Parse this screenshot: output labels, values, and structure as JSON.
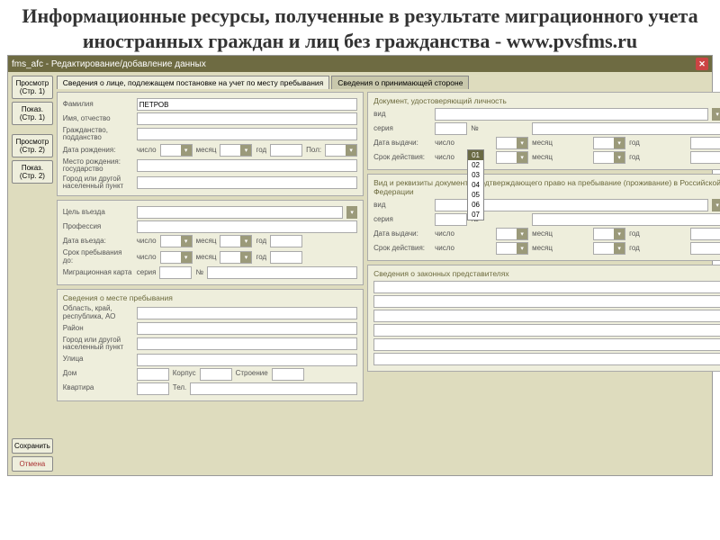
{
  "page_title": "Информационные ресурсы, полученные в результате миграционного учета иностранных граждан и лиц без гражданства - www.pvsfms.ru",
  "window_title": "fms_afc - Редактирование/добавление данных",
  "sidebar": {
    "view_p1": "Просмотр (Стр. 1)",
    "copy_p1": "Показ. (Стр. 1)",
    "view_p2": "Просмотр (Стр. 2)",
    "copy_p2": "Показ. (Стр. 2)",
    "save": "Сохранить",
    "cancel": "Отмена"
  },
  "tabs": {
    "main": "Сведения о лице, подлежащем постановке на учет по месту пребывания",
    "host": "Сведения о принимающей стороне"
  },
  "person": {
    "surname_lbl": "Фамилия",
    "surname_val": "ПЕТРОВ",
    "name_lbl": "Имя, отчество",
    "citizenship_lbl": "Гражданство, подданство",
    "dob_lbl": "Дата рождения:",
    "day_lbl": "число",
    "month_lbl": "месяц",
    "year_lbl": "год",
    "sex_lbl": "Пол:",
    "pob_country_lbl": "Место рождения: государство",
    "pob_city_lbl": "Город или другой населенный пункт"
  },
  "entry": {
    "purpose_lbl": "Цель въезда",
    "profession_lbl": "Профессия",
    "arrival_lbl": "Дата въезда:",
    "stay_lbl": "Срок пребывания до:",
    "migcard_lbl": "Миграционная карта",
    "series_lbl": "серия",
    "number_lbl": "№"
  },
  "doc": {
    "title": "Документ, удостоверяющий личность",
    "kind_lbl": "вид",
    "series_lbl": "серия",
    "num_lbl": "№",
    "issued_lbl": "Дата выдачи:",
    "valid_lbl": "Срок действия:",
    "dropdown_options": [
      "01",
      "02",
      "03",
      "04",
      "05",
      "06",
      "07"
    ]
  },
  "right": {
    "title": "Вид и реквизиты документа, подтверждающего право на пребывание (проживание) в Российской Федерации",
    "kind_lbl": "вид",
    "series_lbl": "серия",
    "num_lbl": "№",
    "issued_lbl": "Дата выдачи:",
    "valid_lbl": "Срок действия:"
  },
  "stay": {
    "title": "Сведения о месте пребывания",
    "region_lbl": "Область, край, республика, АО",
    "district_lbl": "Район",
    "city_lbl": "Город или другой населенный пункт",
    "street_lbl": "Улица",
    "house_lbl": "Дом",
    "block_lbl": "Корпус",
    "building_lbl": "Строение",
    "flat_lbl": "Квартира",
    "phone_lbl": "Тел."
  },
  "rep": {
    "title": "Сведения о законных представителях"
  }
}
